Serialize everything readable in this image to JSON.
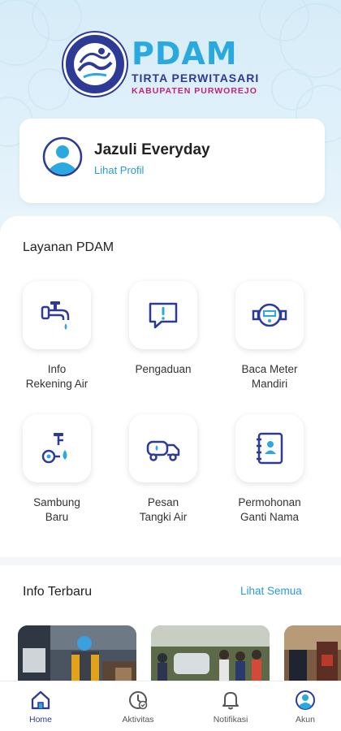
{
  "header": {
    "logo": {
      "title": "PDAM",
      "subtitle": "TIRTA PERWITASARI",
      "region": "KABUPATEN PURWOREJO"
    }
  },
  "profile": {
    "name": "Jazuli Everyday",
    "link_label": "Lihat Profil"
  },
  "services": {
    "title": "Layanan PDAM",
    "items": [
      {
        "label": "Info\nRekening Air",
        "icon": "water-tap-icon"
      },
      {
        "label": "Pengaduan",
        "icon": "complaint-chat-icon"
      },
      {
        "label": "Baca Meter\nMandiri",
        "icon": "water-meter-icon"
      },
      {
        "label": "Sambung\nBaru",
        "icon": "new-connection-icon"
      },
      {
        "label": "Pesan\nTangki Air",
        "icon": "water-truck-icon"
      },
      {
        "label": "Permohonan\nGanti Nama",
        "icon": "contact-book-icon"
      }
    ]
  },
  "news": {
    "title": "Info Terbaru",
    "see_all_label": "Lihat Semua"
  },
  "bottom_nav": {
    "items": [
      {
        "label": "Home",
        "icon": "home-icon",
        "active": true
      },
      {
        "label": "Aktivitas",
        "icon": "activity-icon",
        "active": false
      },
      {
        "label": "Notifikasi",
        "icon": "bell-icon",
        "active": false
      },
      {
        "label": "Akun",
        "icon": "account-icon",
        "active": false
      }
    ]
  },
  "colors": {
    "brand_blue": "#2d3a96",
    "accent_cyan": "#2aa9e0",
    "link_blue": "#2a9ad6",
    "brand_magenta": "#c0237a"
  }
}
